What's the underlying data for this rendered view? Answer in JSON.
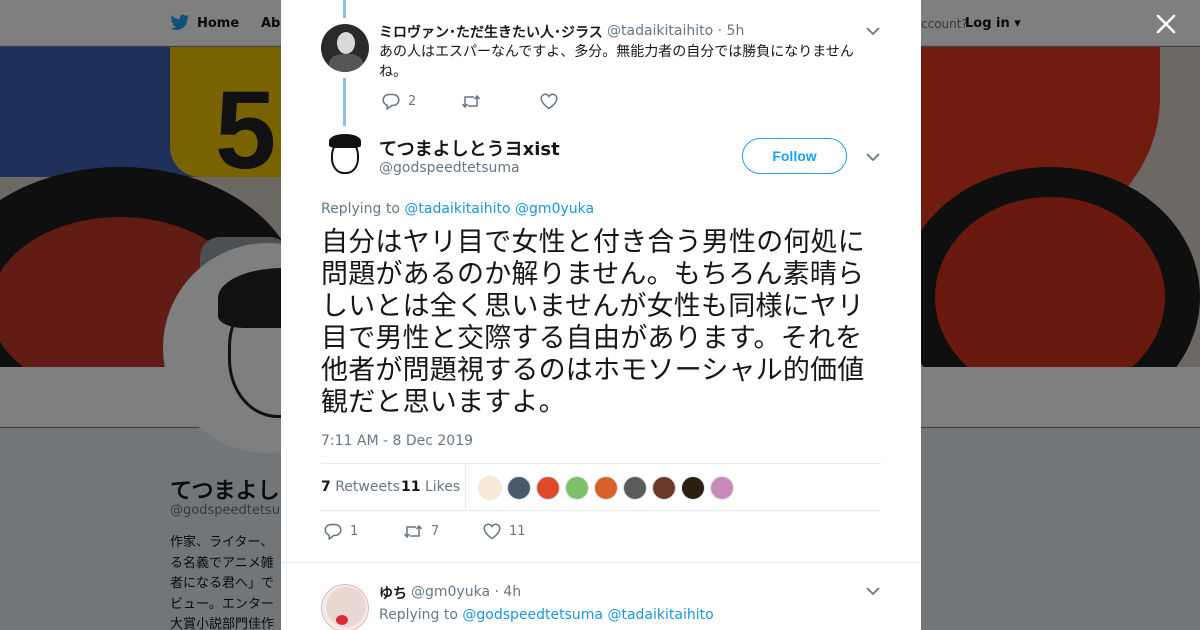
{
  "background": {
    "nav": {
      "home_label": "Home",
      "about_label": "Abo",
      "account_prompt": "ccount?",
      "login_label": "Log in"
    },
    "profile": {
      "name": "てつまよし",
      "handle": "@godspeedtetsum",
      "bio_lines": [
        "作家、ライター、",
        "る名義でアニメ雑",
        "者になる君へ」で",
        "ビュー。エンター",
        "大賞小説部門佳作"
      ]
    }
  },
  "modal": {
    "parent_tweet": {
      "name": "ミロヴァン･ただ生きたい人･ジラス",
      "handle": "@tadaikitaihito",
      "time": "· 5h",
      "text": "あの人はエスパーなんですよ、多分。無能力者の自分では勝負になりませんね。",
      "reply_count": "2",
      "retweet_count": "",
      "like_count": ""
    },
    "main_tweet": {
      "name": "てつまよしとうヨxist",
      "handle": "@godspeedtetsuma",
      "follow_label": "Follow",
      "replying_prefix": "Replying to",
      "replying_to": [
        "@tadaikitaihito",
        "@gm0yuka"
      ],
      "text_lines": [
        "自分はヤリ目で女性と付き合う男性の何処に",
        "問題があるのか解りません。もちろん素晴ら",
        "しいとは全く思いませんが女性も同様にヤリ",
        "目で男性と交際する自由があります。それを",
        "他者が問題視するのはホモソーシャル的価値",
        "観だと思いますよ。"
      ],
      "timestamp": "7:11 AM - 8 Dec 2019",
      "retweets_count": "7",
      "retweets_label": "Retweets",
      "likes_count": "11",
      "likes_label": "Likes",
      "action_reply_count": "1",
      "action_retweet_count": "7",
      "action_like_count": "11"
    },
    "reply_tweet": {
      "name": "ゆち",
      "handle": "@gm0yuka",
      "time": "· 4h",
      "replying_prefix": "Replying to",
      "replying_to": [
        "@godspeedtetsuma",
        "@tadaikitaihito"
      ]
    }
  },
  "colors": {
    "accent": "#1da1f2",
    "mention": "#1b95e0",
    "secondary_text": "#657786"
  },
  "icons": [
    "twitter-bird-icon",
    "close-icon",
    "chevron-down-icon",
    "reply-icon",
    "retweet-icon",
    "heart-icon"
  ]
}
